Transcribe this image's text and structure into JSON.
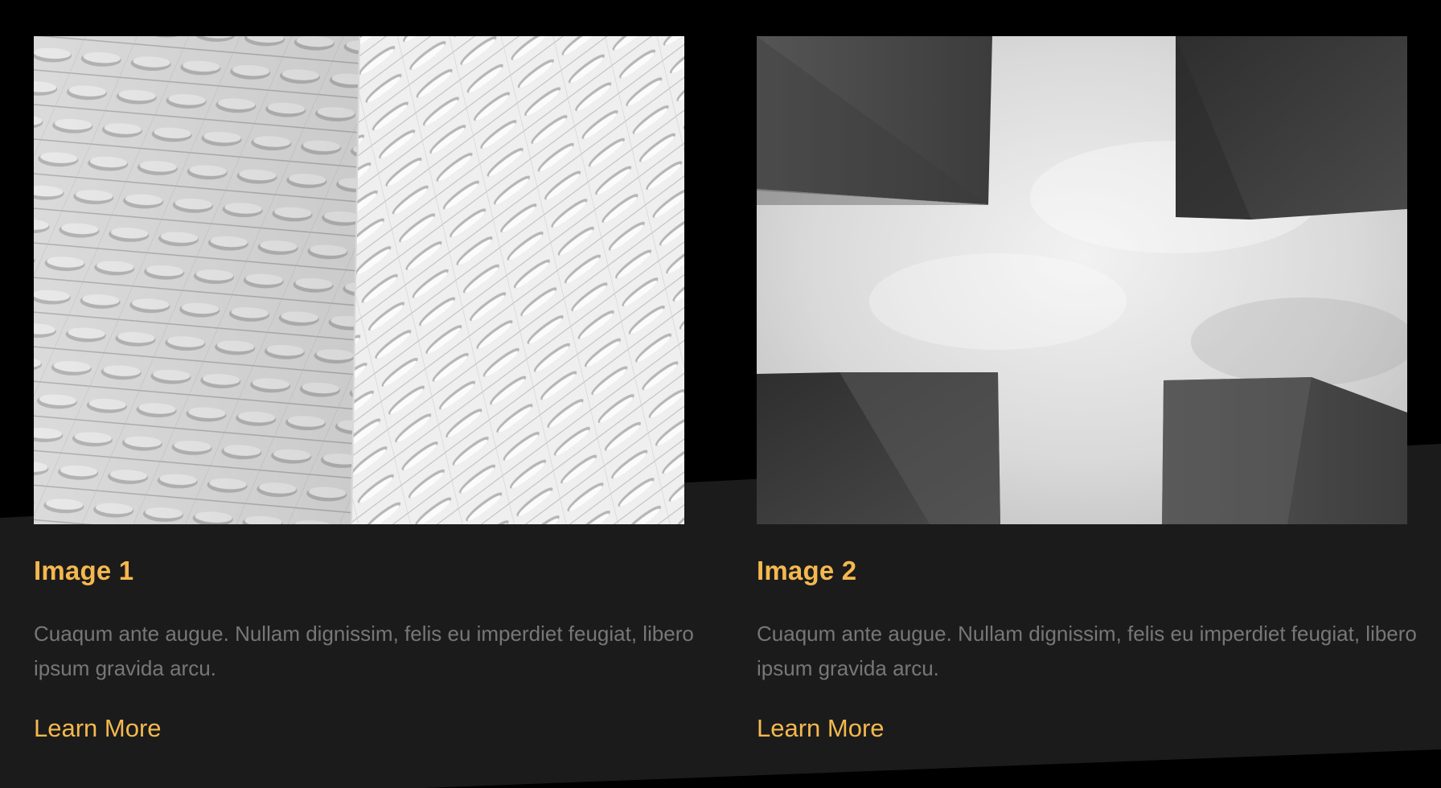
{
  "cards": [
    {
      "title": "Image 1",
      "description": "Cuaqum ante augue. Nullam dignissim, felis eu imperdiet feugiat, libero ipsum gravida arcu.",
      "link_label": "Learn More",
      "image_subject": "white-facade-pattern"
    },
    {
      "title": "Image 2",
      "description": "Cuaqum ante augue. Nullam dignissim, felis eu imperdiet feugiat, libero ipsum gravida arcu.",
      "link_label": "Learn More",
      "image_subject": "concrete-pillars-sky"
    }
  ],
  "colors": {
    "background": "#000000",
    "band": "#1b1b1b",
    "accent": "#f4b84f",
    "body_text": "#777777"
  }
}
